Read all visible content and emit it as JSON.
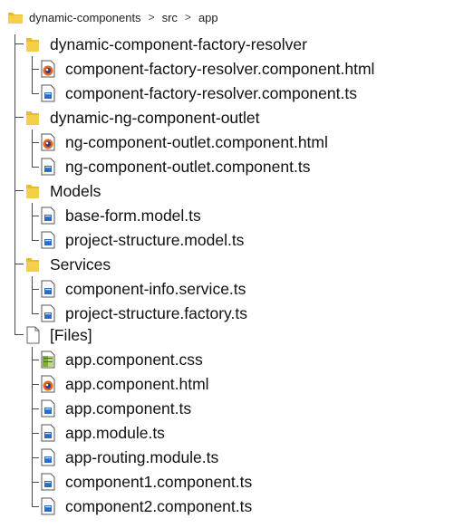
{
  "breadcrumb": {
    "root": "dynamic-components",
    "separator": ">",
    "src": "src",
    "app": "app"
  },
  "tree": {
    "folder1": {
      "name": "dynamic-component-factory-resolver",
      "files": [
        {
          "name": "component-factory-resolver.component.html",
          "icon": "html-file-icon"
        },
        {
          "name": "component-factory-resolver.component.ts",
          "icon": "ts-file-icon"
        }
      ]
    },
    "folder2": {
      "name": "dynamic-ng-component-outlet",
      "files": [
        {
          "name": "ng-component-outlet.component.html",
          "icon": "html-file-icon"
        },
        {
          "name": "ng-component-outlet.component.ts",
          "icon": "ts-file-icon"
        }
      ]
    },
    "folder3": {
      "name": "Models",
      "files": [
        {
          "name": "base-form.model.ts",
          "icon": "ts-file-icon"
        },
        {
          "name": "project-structure.model.ts",
          "icon": "ts-file-icon"
        }
      ]
    },
    "folder4": {
      "name": "Services",
      "files": [
        {
          "name": "component-info.service.ts",
          "icon": "ts-file-icon"
        },
        {
          "name": "project-structure.factory.ts",
          "icon": "ts-file-icon"
        }
      ]
    },
    "folder5": {
      "name": "[Files]",
      "files": [
        {
          "name": "app.component.css",
          "icon": "css-file-icon"
        },
        {
          "name": "app.component.html",
          "icon": "html-file-icon"
        },
        {
          "name": "app.component.ts",
          "icon": "ts-file-icon"
        },
        {
          "name": "app.module.ts",
          "icon": "ts-file-icon"
        },
        {
          "name": "app-routing.module.ts",
          "icon": "ts-file-icon"
        },
        {
          "name": "component1.component.ts",
          "icon": "ts-file-icon"
        },
        {
          "name": "component2.component.ts",
          "icon": "ts-file-icon"
        }
      ]
    }
  }
}
